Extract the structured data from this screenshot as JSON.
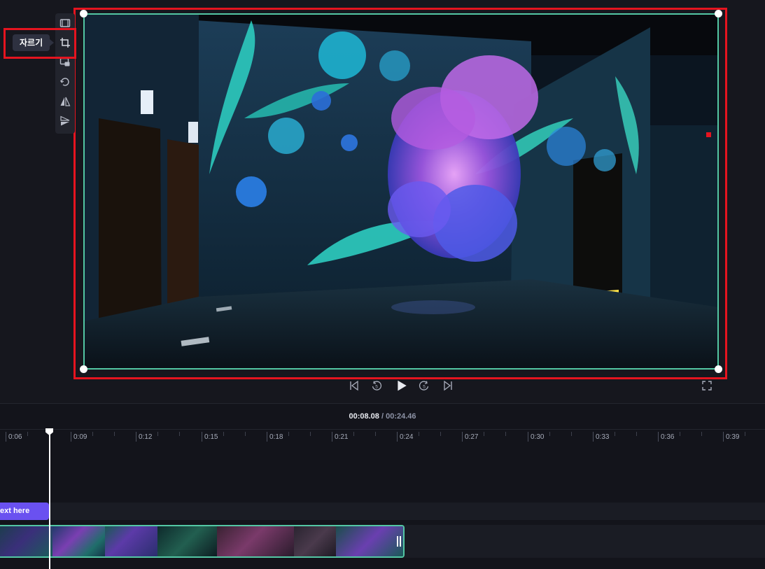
{
  "tooltip": {
    "label": "자르기"
  },
  "toolbar": {
    "items": [
      {
        "name": "fit-icon"
      },
      {
        "name": "crop-icon"
      },
      {
        "name": "picture-in-picture-icon"
      },
      {
        "name": "rotate-icon"
      },
      {
        "name": "flip-horizontal-icon"
      },
      {
        "name": "flip-vertical-icon"
      }
    ]
  },
  "playback": {
    "current_time": "00:08.08",
    "separator": " / ",
    "total_time": "00:24.46",
    "skip_seconds": "5"
  },
  "timeline": {
    "ticks": [
      "0:06",
      "0:09",
      "0:12",
      "0:15",
      "0:18",
      "0:21",
      "0:24",
      "0:27",
      "0:30",
      "0:33",
      "0:36",
      "0:39"
    ]
  },
  "text_clip": {
    "label": "ext here"
  },
  "colors": {
    "accent": "#53c7a4",
    "highlight": "#e5141f",
    "text_clip": "#6a51f0",
    "background": "#13141b"
  }
}
